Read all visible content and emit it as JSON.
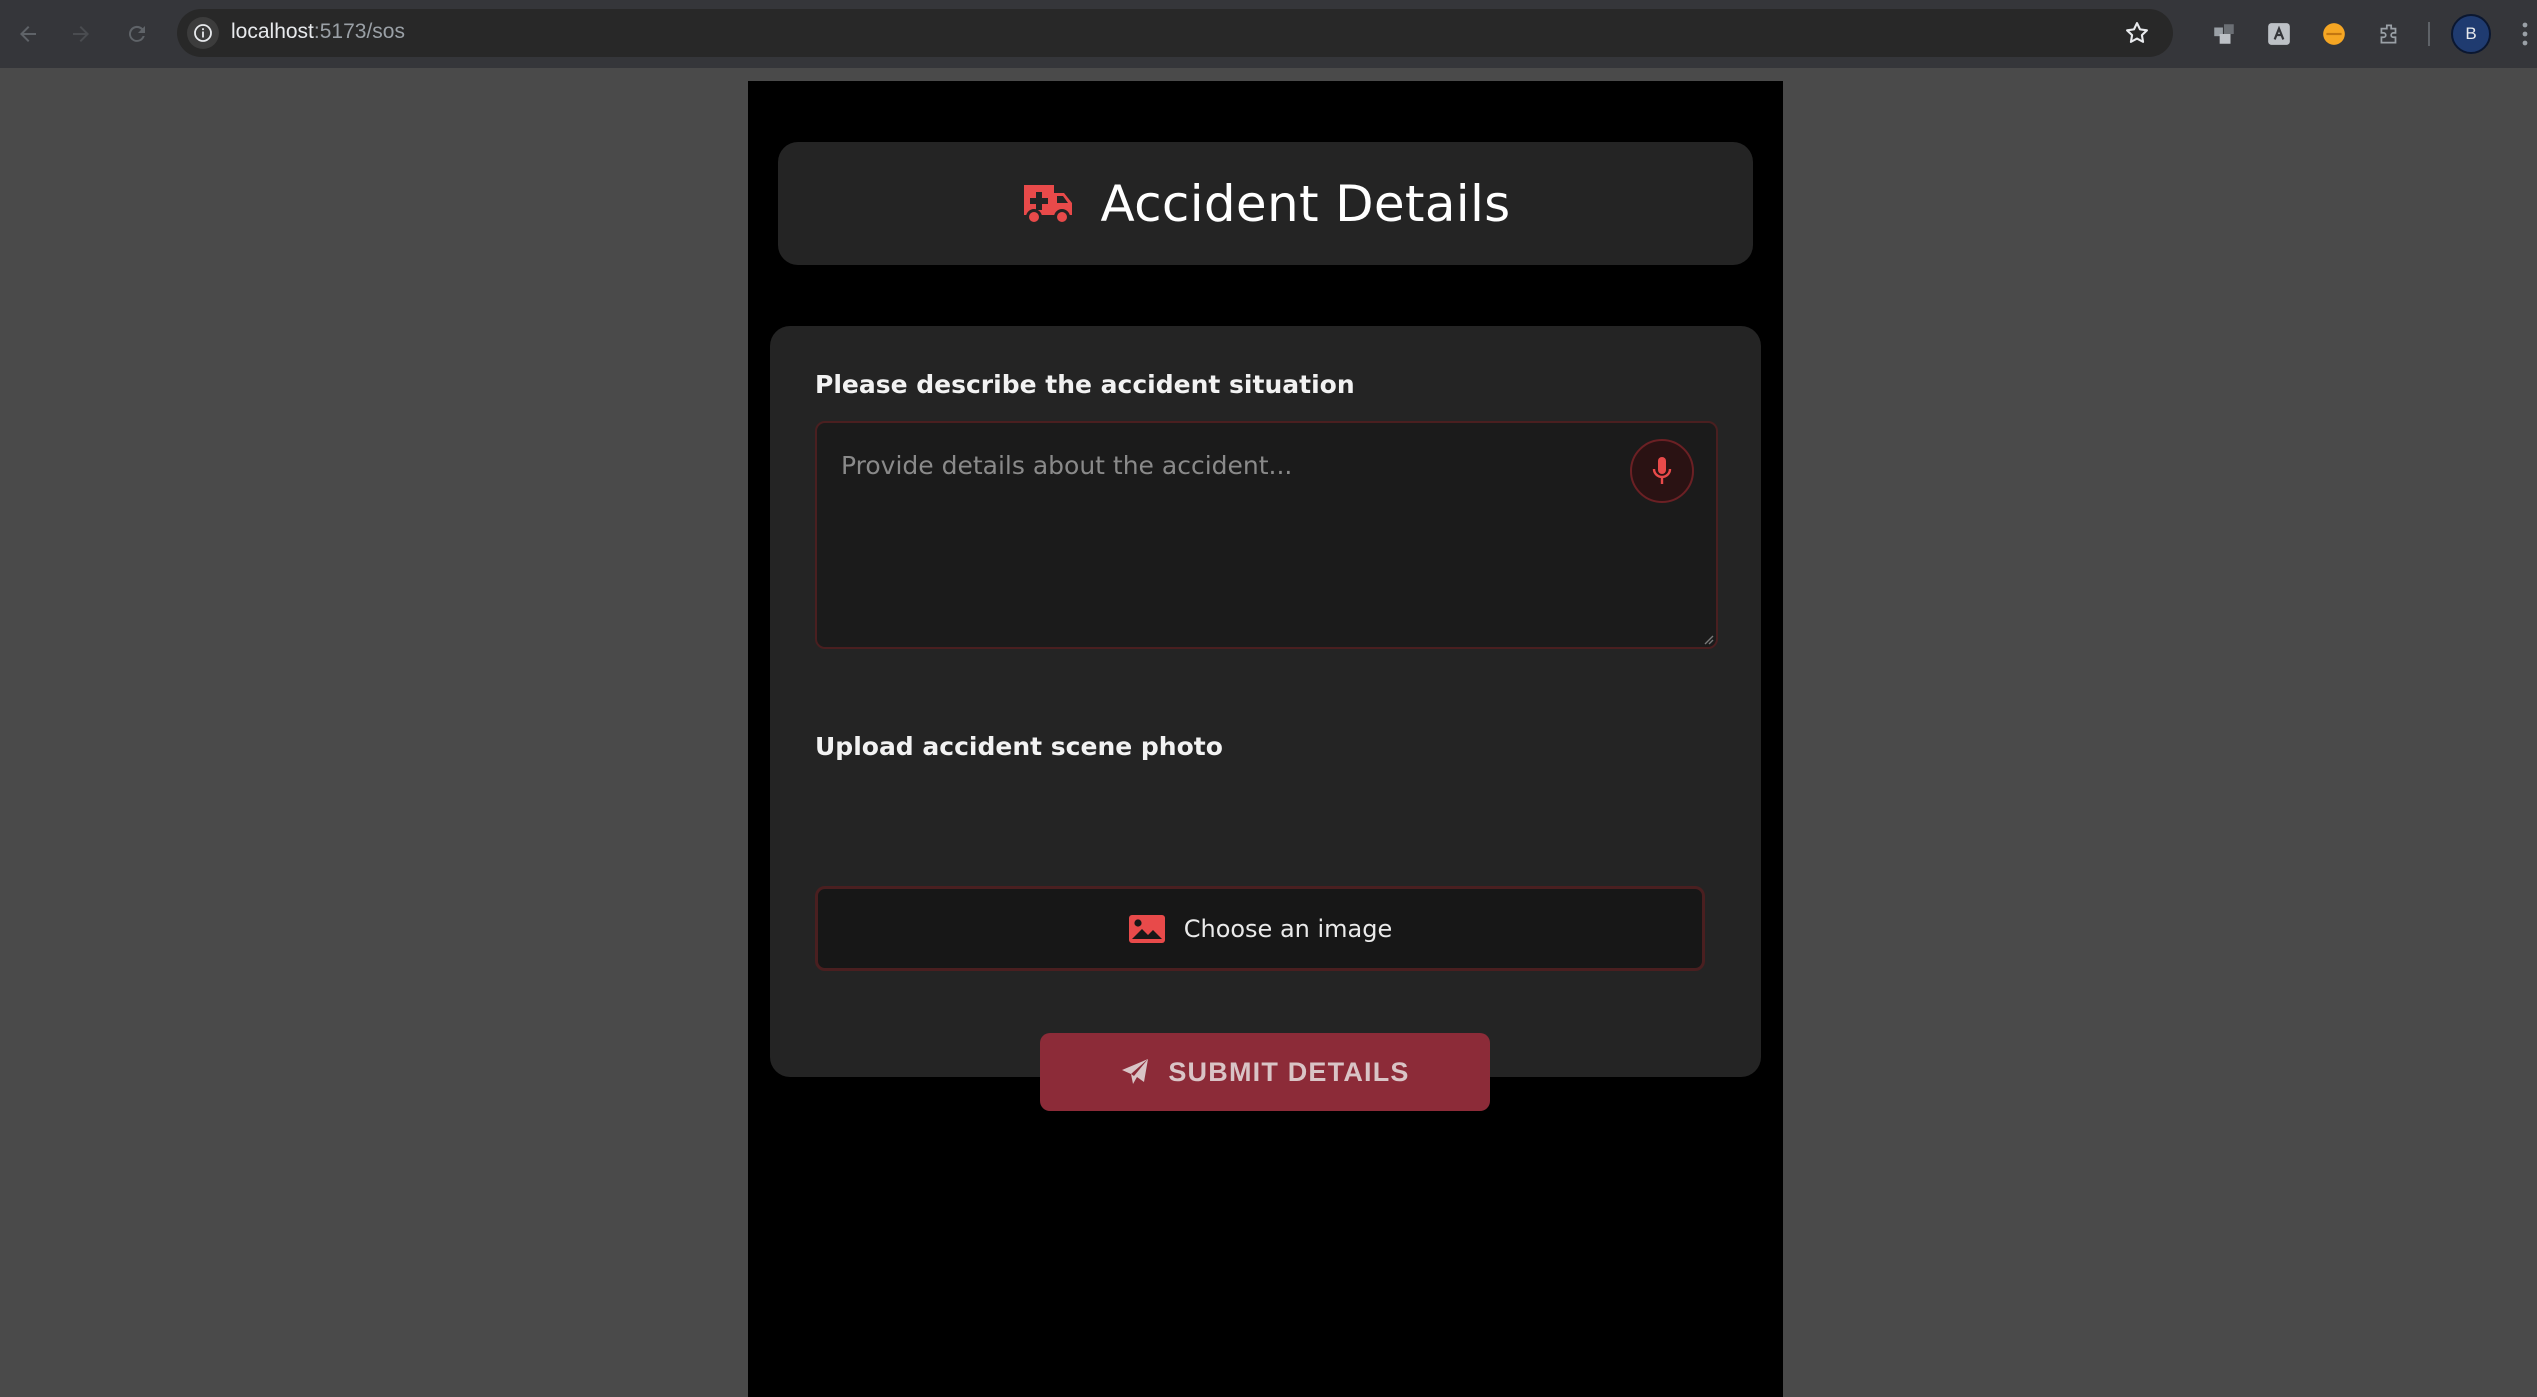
{
  "browser": {
    "url_host": "localhost",
    "url_path": ":5173/sos",
    "profile_initial": "B"
  },
  "page": {
    "title": "Accident Details",
    "description_label": "Please describe the accident situation",
    "description_placeholder": "Provide details about the accident...",
    "upload_label": "Upload accident scene photo",
    "upload_button_label": "Choose an image",
    "submit_button_label": "SUBMIT DETAILS"
  },
  "colors": {
    "accent": "#e84a4a",
    "submit_bg": "#8c2b38",
    "card_bg": "#242424",
    "page_bg": "#000000"
  }
}
